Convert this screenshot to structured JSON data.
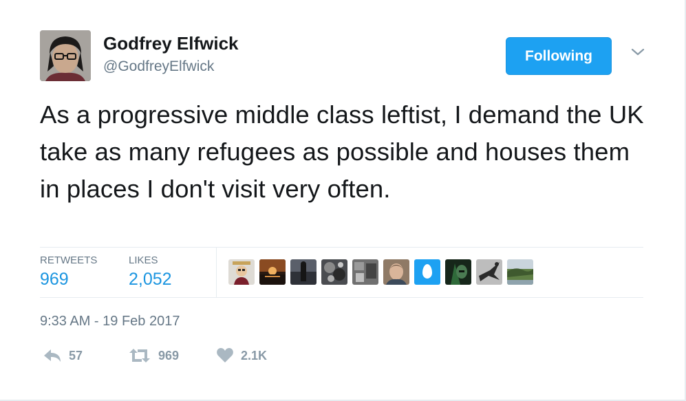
{
  "user": {
    "name": "Godfrey Elfwick",
    "handle": "@GodfreyElfwick",
    "avatar_icon": "user-avatar-photo"
  },
  "follow_button": {
    "label": "Following",
    "color": "#1da1f2"
  },
  "menu_icon": "chevron-down-icon",
  "tweet": {
    "text": "As a progressive middle class leftist, I demand the UK take as many refugees as possible and houses them in places I don't visit very often.",
    "timestamp": "9:33 AM - 19 Feb 2017"
  },
  "stats": {
    "retweets_label": "RETWEETS",
    "retweets": "969",
    "likes_label": "LIKES",
    "likes": "2,052",
    "value_color": "#1b95e0"
  },
  "likers": [
    {
      "icon": "cartoon-avatar",
      "bg": "#d8d5cf"
    },
    {
      "icon": "sunset-avatar",
      "bg": "#7a4a2a"
    },
    {
      "icon": "dark-figure-avatar",
      "bg": "#3d4048"
    },
    {
      "icon": "bw-photo-avatar",
      "bg": "#55575a"
    },
    {
      "icon": "bw-texture-avatar",
      "bg": "#6b6b6b"
    },
    {
      "icon": "face-avatar",
      "bg": "#a8907a"
    },
    {
      "icon": "default-egg-avatar",
      "bg": "#1da1f2"
    },
    {
      "icon": "dark-green-avatar",
      "bg": "#1e3a24"
    },
    {
      "icon": "bird-sketch-avatar",
      "bg": "#9a9a9a"
    },
    {
      "icon": "landscape-avatar",
      "bg": "#6d8a52"
    }
  ],
  "actions": {
    "reply_count": "57",
    "retweet_count": "969",
    "like_count": "2.1K",
    "icon_color": "#aab8c2"
  }
}
